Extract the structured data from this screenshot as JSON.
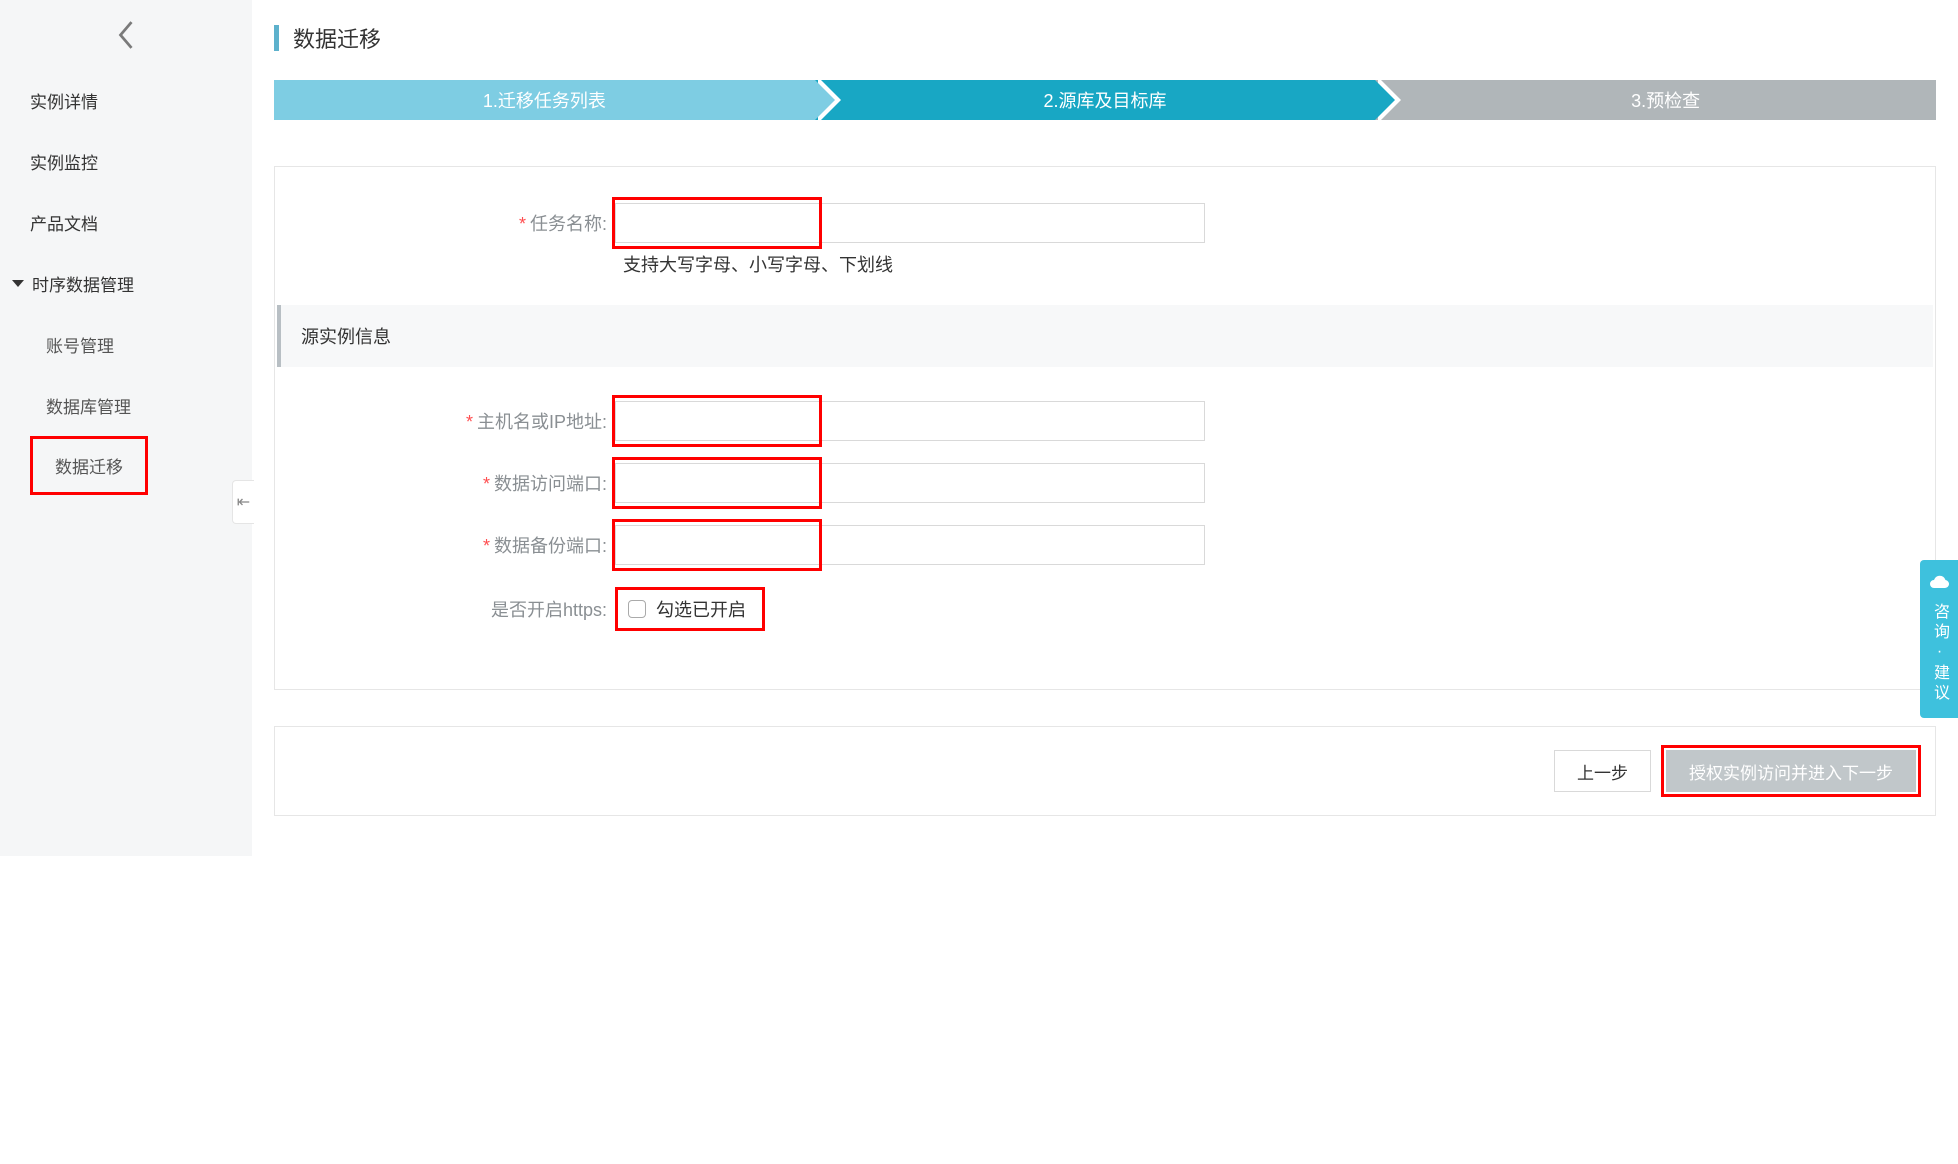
{
  "sidebar": {
    "items": [
      {
        "label": "实例详情"
      },
      {
        "label": "实例监控"
      },
      {
        "label": "产品文档"
      }
    ],
    "group": {
      "label": "时序数据管理",
      "children": [
        {
          "label": "账号管理"
        },
        {
          "label": "数据库管理"
        },
        {
          "label": "数据迁移",
          "active": true
        }
      ]
    }
  },
  "page": {
    "title": "数据迁移"
  },
  "steps": {
    "s1": "1.迁移任务列表",
    "s2": "2.源库及目标库",
    "s3": "3.预检查"
  },
  "form": {
    "taskName": {
      "label": "任务名称:",
      "value": "",
      "helper": "支持大写字母、小写字母、下划线"
    },
    "sectionTitle": "源实例信息",
    "host": {
      "label": "主机名或IP地址:",
      "value": ""
    },
    "dataPort": {
      "label": "数据访问端口:",
      "value": ""
    },
    "backupPort": {
      "label": "数据备份端口:",
      "value": ""
    },
    "https": {
      "label": "是否开启https:",
      "checkboxLabel": "勾选已开启",
      "checked": false
    }
  },
  "footer": {
    "prev": "上一步",
    "next": "授权实例访问并进入下一步"
  },
  "feedback": {
    "label": "咨询·建议"
  }
}
